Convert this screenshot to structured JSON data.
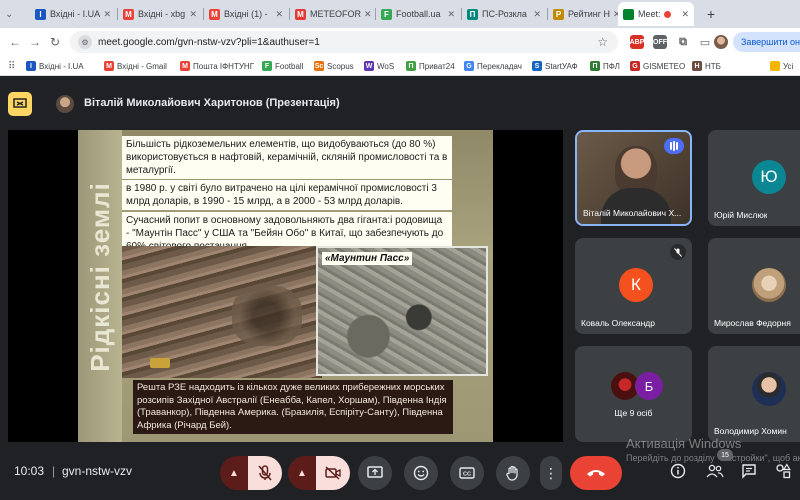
{
  "browser": {
    "tabs": [
      {
        "label": "Вхідні - I.UA",
        "icon_text": "I",
        "icon_color": "#1a57c0"
      },
      {
        "label": "Вхідні - xbg",
        "icon_text": "M",
        "icon_color": "#ea4335"
      },
      {
        "label": "Вхідні (1) -",
        "icon_text": "M",
        "icon_color": "#ea4335"
      },
      {
        "label": "METEOFOR",
        "icon_text": "M",
        "icon_color": "#e53935"
      },
      {
        "label": "Football.ua",
        "icon_text": "F",
        "icon_color": "#34a853"
      },
      {
        "label": "ПС-Розкла",
        "icon_text": "П",
        "icon_color": "#00897b"
      },
      {
        "label": "Рейтинг Н",
        "icon_text": "Р",
        "icon_color": "#c28a00"
      },
      {
        "label": "Meet:",
        "icon_text": "",
        "icon_color": "#00832d",
        "active": true
      }
    ],
    "new_tab": "+",
    "url": "meet.google.com/gvn-nstw-vzv?pli=1&authuser=1",
    "finish_button": "Завершити онов",
    "extensions": [
      "ABP",
      "OFF"
    ]
  },
  "bookmarks": [
    {
      "label": "Вхідні - I.UA",
      "icon_text": "I",
      "icon_color": "#1a57c0"
    },
    {
      "label": "Вхідні - Gmail",
      "icon_text": "M",
      "icon_color": "#ea4335"
    },
    {
      "label": "Пошта ІФНТУНГ",
      "icon_text": "M",
      "icon_color": "#ea4335"
    },
    {
      "label": "Football",
      "icon_text": "F",
      "icon_color": "#34a853"
    },
    {
      "label": "Scopus",
      "icon_text": "Sc",
      "icon_color": "#e8710a"
    },
    {
      "label": "WoS",
      "icon_text": "W",
      "icon_color": "#5e35b1"
    },
    {
      "label": "Приват24",
      "icon_text": "П",
      "icon_color": "#43a047"
    },
    {
      "label": "Перекладач",
      "icon_text": "G",
      "icon_color": "#4285f4"
    },
    {
      "label": "StartУАФ",
      "icon_text": "S",
      "icon_color": "#1565c0"
    },
    {
      "label": "ПФЛ",
      "icon_text": "П",
      "icon_color": "#2e7d32"
    },
    {
      "label": "GISMETEO",
      "icon_text": "G",
      "icon_color": "#c62828"
    },
    {
      "label": "НТБ",
      "icon_text": "Н",
      "icon_color": "#6d4c41"
    },
    {
      "label": "Усі",
      "icon_text": "",
      "icon_color": "#f4b400"
    }
  ],
  "meet": {
    "presenter_title": "Віталій Миколайович Харитонов (Презентація)",
    "slide": {
      "side_title": "Рідкісні землі",
      "para1": "Більшість рідкоземельних елементів, що видобуваються (до 80 %) використовується в нафтовій, керамічній, скляній промисловості та в металургії.",
      "para2": "в 1980 р. у світі було витрачено на цілі керамічної промисловості 3 млрд доларів, в 1990 - 15 млрд, а в 2000 - 53 млрд доларів.",
      "para3": "Сучасний попит в основному задовольняють два гіганта:і родовища - \"Маунтін Пасс\" у США та \"Бейян Обо\" в Китаї, що забезпечують до 60% світового постачання",
      "photo_label": "«Маунтин Пасс»",
      "para4": "Решта РЗЕ надходить із кількох дуже великих прибережних морських розсипів Західної Австралії (Енеабба, Капел, Хоршам), Південна Індія (Траванкор), Південна Америка. (Бразилія, Еспіріту-Санту), Південна Африка (Річард Бей)."
    },
    "participants": [
      {
        "name": "Віталій Миколайович Х...",
        "type": "video"
      },
      {
        "name": "Юрій Мислюк",
        "initial": "Ю",
        "color": "#0b8793"
      },
      {
        "name": "Коваль Олександр",
        "initial": "К",
        "color": "#f4511e"
      },
      {
        "name": "Мирослав Федорня",
        "type": "photo"
      },
      {
        "name": "Ще 9 осіб",
        "initial": "Б",
        "color": "#7b1fa2"
      },
      {
        "name": "Володимир Хомин",
        "type": "photo-portrait"
      }
    ],
    "clock": "10:03",
    "separator": "|",
    "meeting_code": "gvn-nstw-vzv",
    "participant_count": "15",
    "watermark_title": "Активація Windows",
    "watermark_sub": "Перейдіть до розділу \"Настройки\", щоб активувати Windows."
  },
  "colors": {
    "meet_bg": "#202124",
    "accent_yellow": "#fdd663",
    "end_call": "#ea4335",
    "muted_bg": "#f9dedc"
  }
}
